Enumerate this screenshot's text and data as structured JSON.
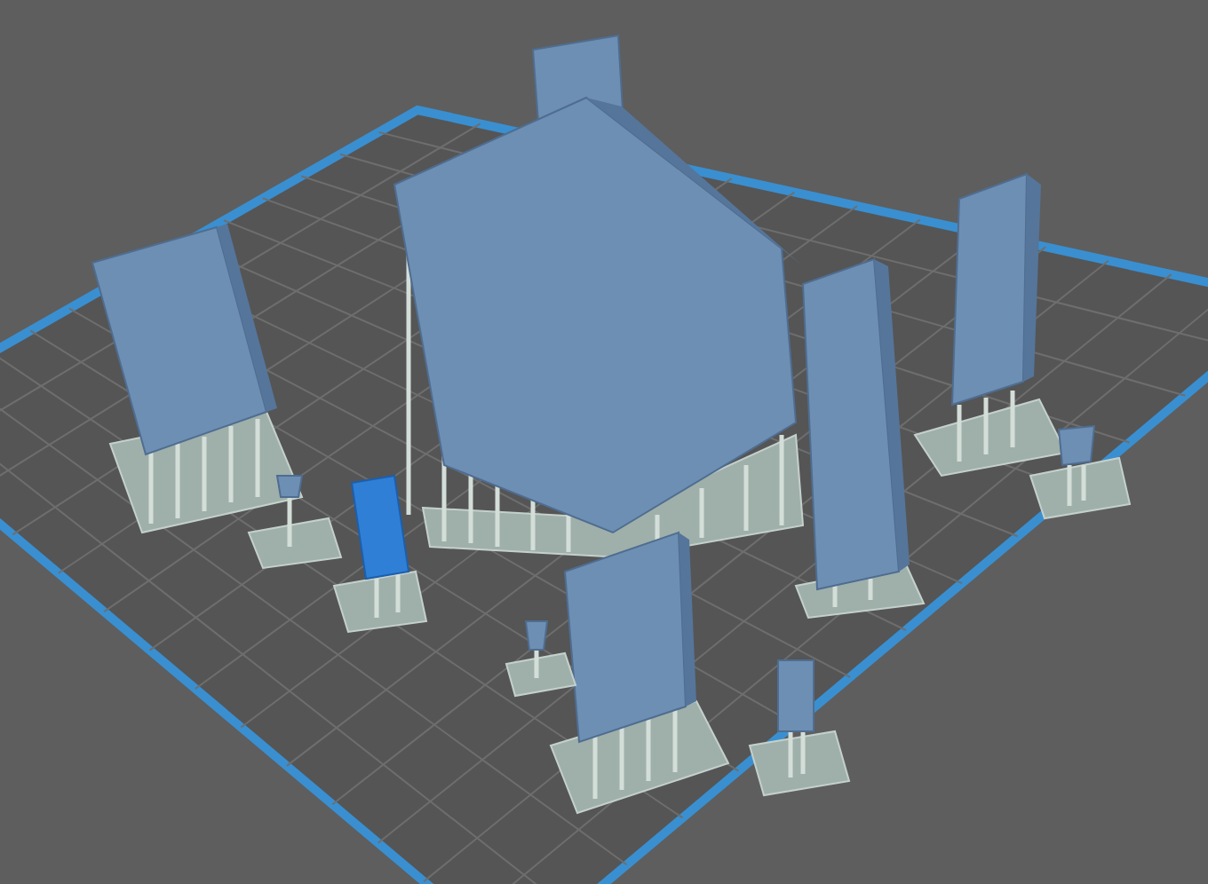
{
  "viewport": {
    "models": [
      {
        "selected": false
      },
      {
        "selected": false
      },
      {
        "selected": false
      },
      {
        "selected": false
      },
      {
        "selected": false
      },
      {
        "selected": true
      },
      {
        "selected": false
      },
      {
        "selected": false
      },
      {
        "selected": false
      },
      {
        "selected": false
      }
    ]
  }
}
